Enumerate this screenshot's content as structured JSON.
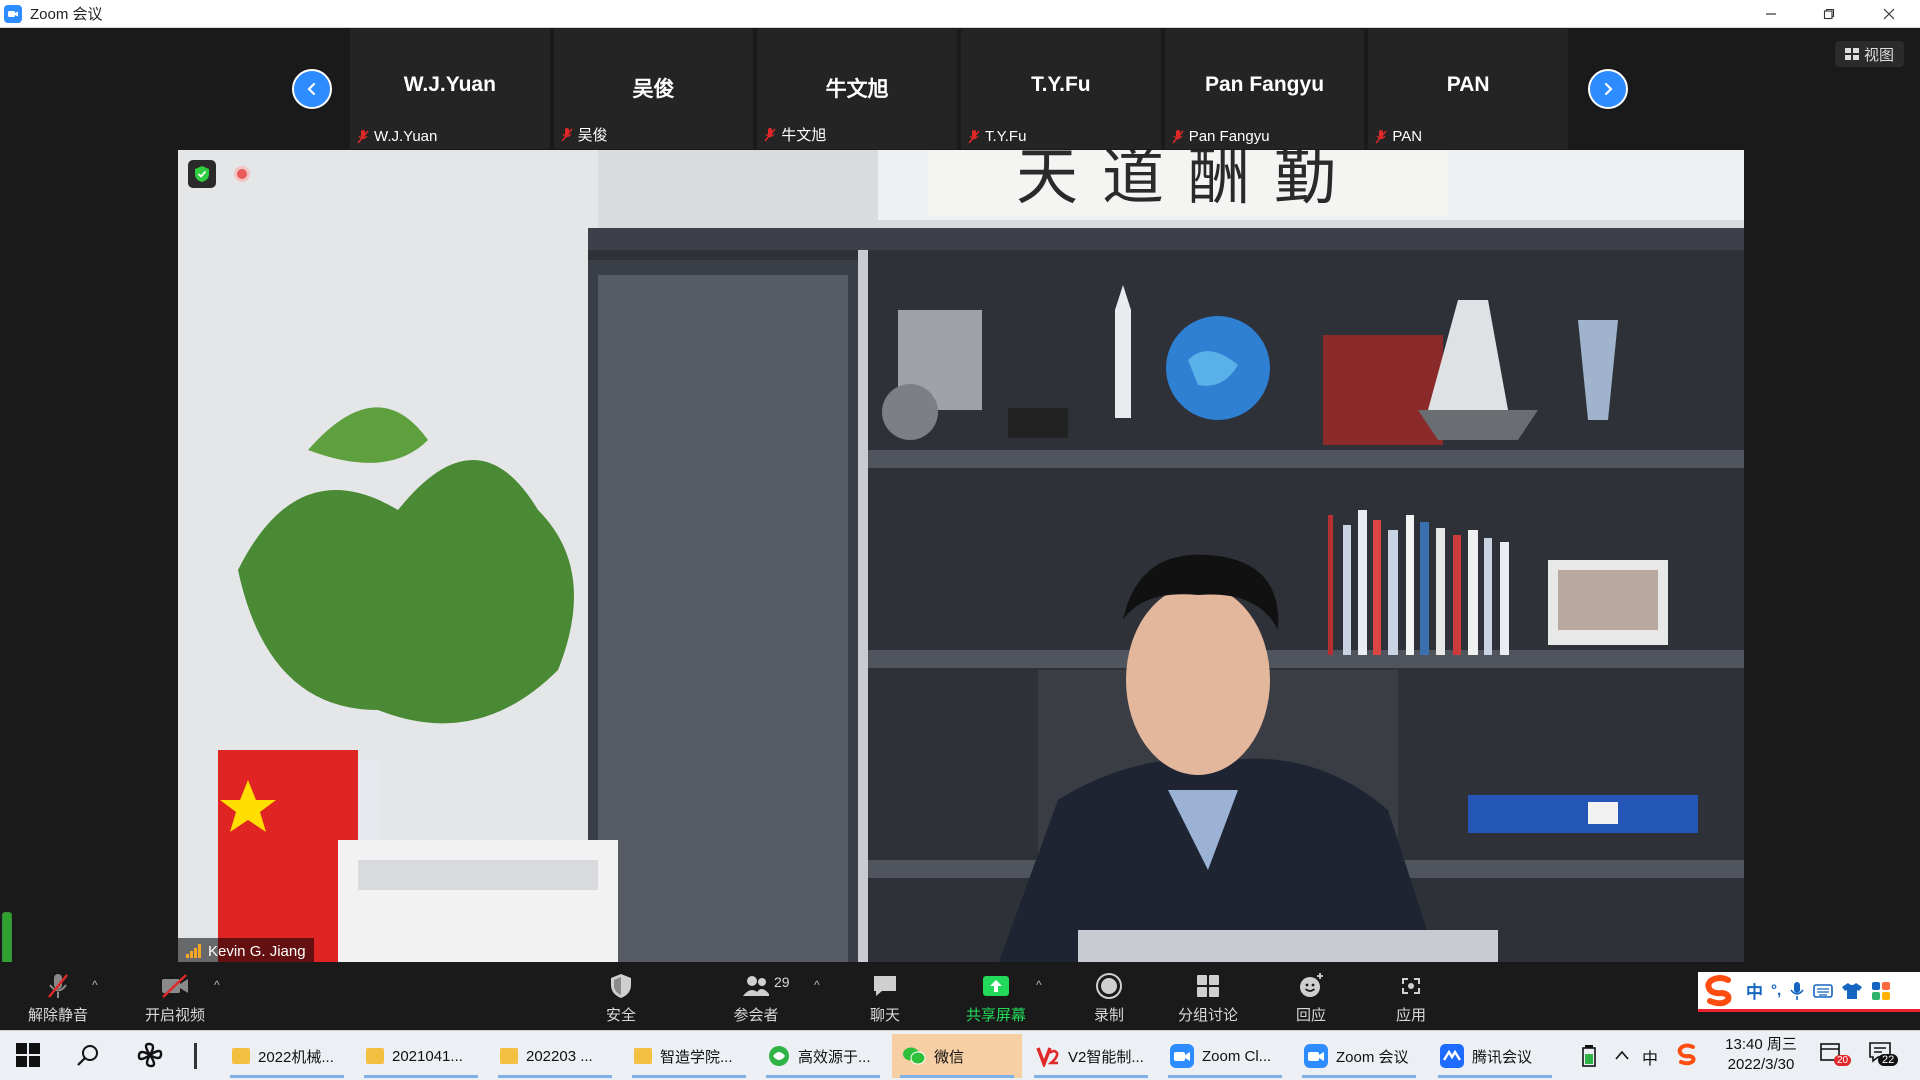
{
  "window": {
    "title": "Zoom 会议"
  },
  "view_button": {
    "label": "视图"
  },
  "participants_strip": [
    {
      "display": "W.J.Yuan",
      "name": "W.J.Yuan"
    },
    {
      "display": "吴俊",
      "name": "吴俊"
    },
    {
      "display": "牛文旭",
      "name": "牛文旭"
    },
    {
      "display": "T.Y.Fu",
      "name": "T.Y.Fu"
    },
    {
      "display": "Pan Fangyu",
      "name": "Pan Fangyu"
    },
    {
      "display": "PAN",
      "name": "PAN"
    }
  ],
  "main_video": {
    "speaker_name": "Kevin G. Jiang",
    "calligraphy": "天道酬勤"
  },
  "toolbar": {
    "unmute": "解除静音",
    "start_video": "开启视频",
    "security": "安全",
    "participants": "参会者",
    "participants_count": "29",
    "chat": "聊天",
    "share_screen": "共享屏幕",
    "record": "录制",
    "breakout": "分组讨论",
    "reactions": "回应",
    "apps": "应用"
  },
  "ime": {
    "lang": "中",
    "punct": "°,"
  },
  "taskbar": {
    "items": [
      {
        "label": "2022机械...",
        "icon": "folder-icon"
      },
      {
        "label": "2021041...",
        "icon": "folder-icon"
      },
      {
        "label": "202203 ...",
        "icon": "folder-icon"
      },
      {
        "label": "智造学院...",
        "icon": "folder-icon"
      },
      {
        "label": "高效源于...",
        "icon": "browser-icon"
      },
      {
        "label": "微信",
        "icon": "wechat-icon"
      },
      {
        "label": "V2智能制...",
        "icon": "v2-icon"
      },
      {
        "label": "Zoom Cl...",
        "icon": "zoom-icon"
      },
      {
        "label": "Zoom 会议",
        "icon": "zoom-icon"
      },
      {
        "label": "腾讯会议",
        "icon": "tencent-meeting-icon"
      }
    ],
    "clock_time": "13:40 周三",
    "clock_date": "2022/3/30",
    "tray_lang": "中",
    "calendar_badge": "20",
    "notification_count": "22"
  },
  "colors": {
    "accent": "#2d8cff",
    "share_green": "#23d959",
    "muted_red": "#e02828"
  }
}
